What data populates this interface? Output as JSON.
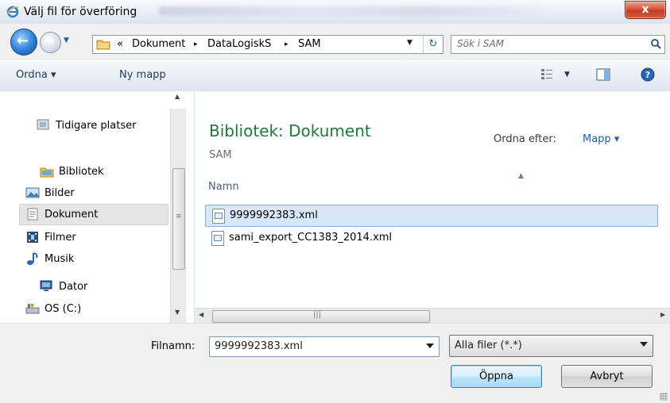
{
  "window": {
    "title": "Välj fil för överföring",
    "close_label": "x"
  },
  "address": {
    "overflow": "«",
    "breadcrumbs": [
      "Dokument",
      "DataLogiskS",
      "SAM"
    ],
    "separator": "▸"
  },
  "search": {
    "placeholder": "Sök i SAM"
  },
  "toolbar": {
    "organize": "Ordna ▾",
    "new_folder": "Ny mapp"
  },
  "nav": {
    "items": [
      {
        "label": "Tidigare platser",
        "icon": "recent-places-icon"
      },
      {
        "label": "Bibliotek",
        "icon": "library-icon"
      },
      {
        "label": "Bilder",
        "icon": "pictures-icon"
      },
      {
        "label": "Dokument",
        "icon": "documents-icon",
        "selected": true
      },
      {
        "label": "Filmer",
        "icon": "videos-icon"
      },
      {
        "label": "Musik",
        "icon": "music-icon"
      },
      {
        "label": "Dator",
        "icon": "computer-icon"
      },
      {
        "label": "OS (C:)",
        "icon": "drive-icon"
      }
    ]
  },
  "main": {
    "library_title": "Bibliotek: Dokument",
    "library_subtitle": "SAM",
    "sort_label": "Ordna efter:",
    "sort_value": "Mapp ▾",
    "column_header": "Namn",
    "files": [
      {
        "name": "9999992383.xml",
        "selected": true
      },
      {
        "name": "sami_export_CC1383_2014.xml",
        "selected": false
      }
    ]
  },
  "bottom": {
    "filename_label": "Filnamn:",
    "filename_value": "9999992383.xml",
    "filter_value": "Alla filer (*.*)",
    "open_button": "Öppna",
    "cancel_button": "Avbryt"
  },
  "colors": {
    "accent_green": "#1e7a38",
    "link_blue": "#1d5fb4",
    "selection": "#d9e8f8"
  }
}
